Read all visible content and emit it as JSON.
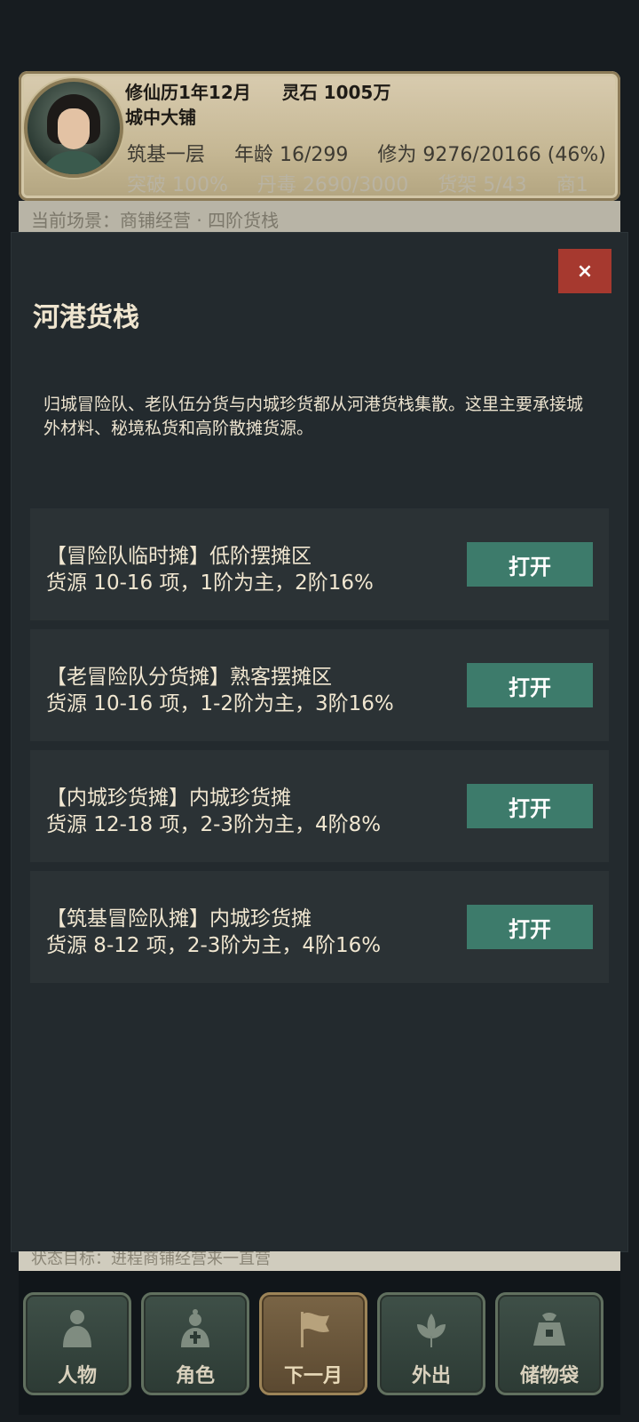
{
  "header": {
    "calendar": "修仙历1年12月",
    "spirit_stone": "灵石 1005万",
    "location": "城中大铺",
    "stats_row1": [
      "筑基一层",
      "年龄 16/299",
      "修为 9276/20166 (46%)"
    ],
    "stats_row2": [
      "突破 100%",
      "丹毒 2690/3000",
      "货架 5/43",
      "商1"
    ],
    "banner_text": "当前场景：商铺经营 · 四阶货栈"
  },
  "modal": {
    "close_label": "×",
    "title": "河港货栈",
    "description": "归城冒险队、老队伍分货与内城珍货都从河港货栈集散。这里主要承接城外材料、秘境私货和高阶散摊货源。",
    "stalls": [
      {
        "name": "【冒险队临时摊】低阶摆摊区",
        "source": "货源 10-16 项，1阶为主，2阶16%",
        "button": "打开"
      },
      {
        "name": "【老冒险队分货摊】熟客摆摊区",
        "source": "货源 10-16 项，1-2阶为主，3阶16%",
        "button": "打开"
      },
      {
        "name": "【内城珍货摊】内城珍货摊",
        "source": "货源 12-18 项，2-3阶为主，4阶8%",
        "button": "打开"
      },
      {
        "name": "【筑基冒险队摊】内城珍货摊",
        "source": "货源 8-12 项，2-3阶为主，4阶16%",
        "button": "打开"
      }
    ]
  },
  "status_strip": "状态目标：进程商铺经营来一直营",
  "bottom_nav": [
    {
      "label": "人物",
      "icon": "person-icon"
    },
    {
      "label": "角色",
      "icon": "cultivator-icon"
    },
    {
      "label": "下一月",
      "icon": "flag-icon"
    },
    {
      "label": "外出",
      "icon": "lotus-icon"
    },
    {
      "label": "储物袋",
      "icon": "bag-icon"
    }
  ],
  "colors": {
    "background": "#171c20",
    "modal": "#232a2e",
    "stall": "#2b3235",
    "open_button": "#3d7b6b",
    "close_button": "#a6392f"
  }
}
